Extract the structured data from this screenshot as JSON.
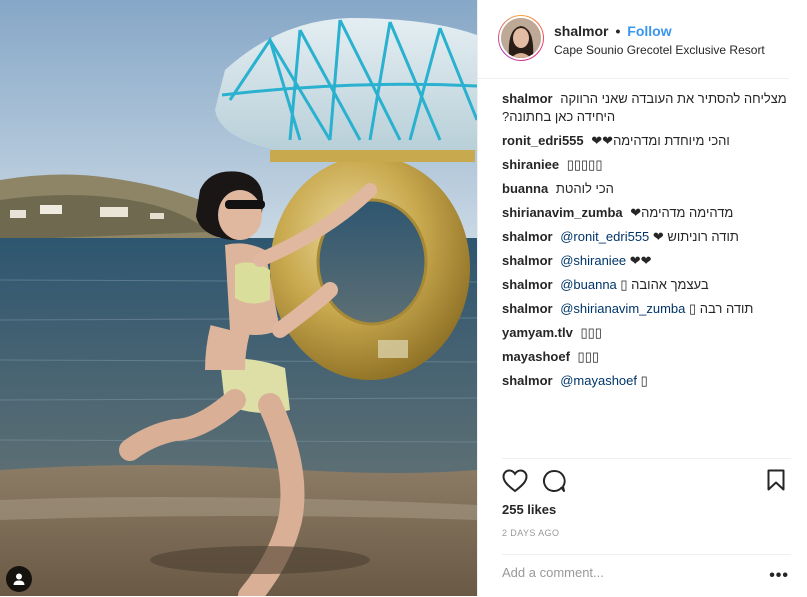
{
  "post": {
    "username": "shalmor",
    "separator": "•",
    "follow_label": "Follow",
    "location": "Cape Sounio Grecotel Exclusive Resort",
    "caption": "מצליחה להסתיר את העובדה שאני הרווקה היחידה כאן בחתונה?",
    "comments": [
      {
        "user": "ronit_edri555",
        "text": "והכי מיוחדת ומדהימה❤❤"
      },
      {
        "user": "shiraniee",
        "text": "▯▯▯▯▯"
      },
      {
        "user": "buanna",
        "text": "הכי לוהטת"
      },
      {
        "user": "shirianavim_zumba",
        "text": "מדהימה מדהימה❤"
      },
      {
        "user": "shalmor",
        "mention": "@ronit_edri555",
        "text": "תודה רוניתוש ❤"
      },
      {
        "user": "shalmor",
        "mention": "@shiraniee",
        "text": "❤❤"
      },
      {
        "user": "shalmor",
        "mention": "@buanna",
        "text": "בעצמך אהובה ▯"
      },
      {
        "user": "shalmor",
        "mention": "@shirianavim_zumba",
        "text": "תודה רבה ▯"
      },
      {
        "user": "yamyam.tlv",
        "text": "▯▯▯"
      },
      {
        "user": "mayashoef",
        "text": "▯▯▯"
      },
      {
        "user": "shalmor",
        "mention": "@mayashoef",
        "text": "▯"
      }
    ],
    "likes": "255 likes",
    "time": "2 DAYS AGO",
    "add_comment_placeholder": "Add a comment...",
    "more_label": "•••"
  },
  "icons": {
    "like": "heart-icon",
    "comment": "comment-bubble-icon",
    "save": "bookmark-icon",
    "user_tag": "person-icon"
  }
}
